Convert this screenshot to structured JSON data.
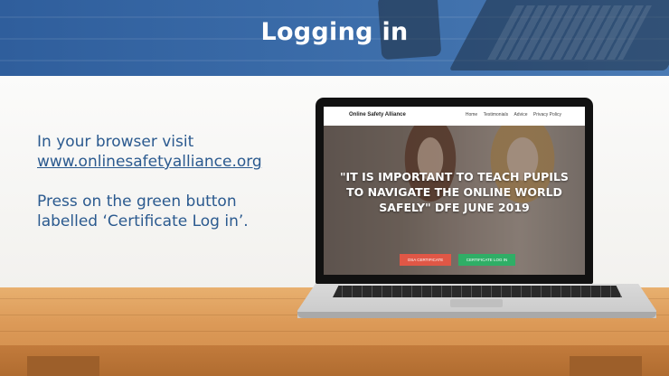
{
  "slide": {
    "title": "Logging in",
    "instructions": {
      "line1": "In your browser visit",
      "url": "www.onlinesafetyalliance.org",
      "line3": "Press on the green button",
      "line4": "labelled ‘Certificate Log in’."
    }
  },
  "website": {
    "logo": "Online Safety Alliance",
    "nav": [
      "Home",
      "Testimonials",
      "Advice",
      "Privacy Policy"
    ],
    "hero_quote": "\"IT IS IMPORTANT TO TEACH PUPILS TO NAVIGATE THE ONLINE WORLD SAFELY\" DFE JUNE 2019",
    "buttons": {
      "osa_certificate": "OSA CERTIFICATE",
      "certificate_login": "CERTIFICATE LOG IN"
    }
  },
  "colors": {
    "banner": "#2f5e9c",
    "text": "#2b5a8f",
    "red_button": "#e05746",
    "green_button": "#2fae66"
  }
}
